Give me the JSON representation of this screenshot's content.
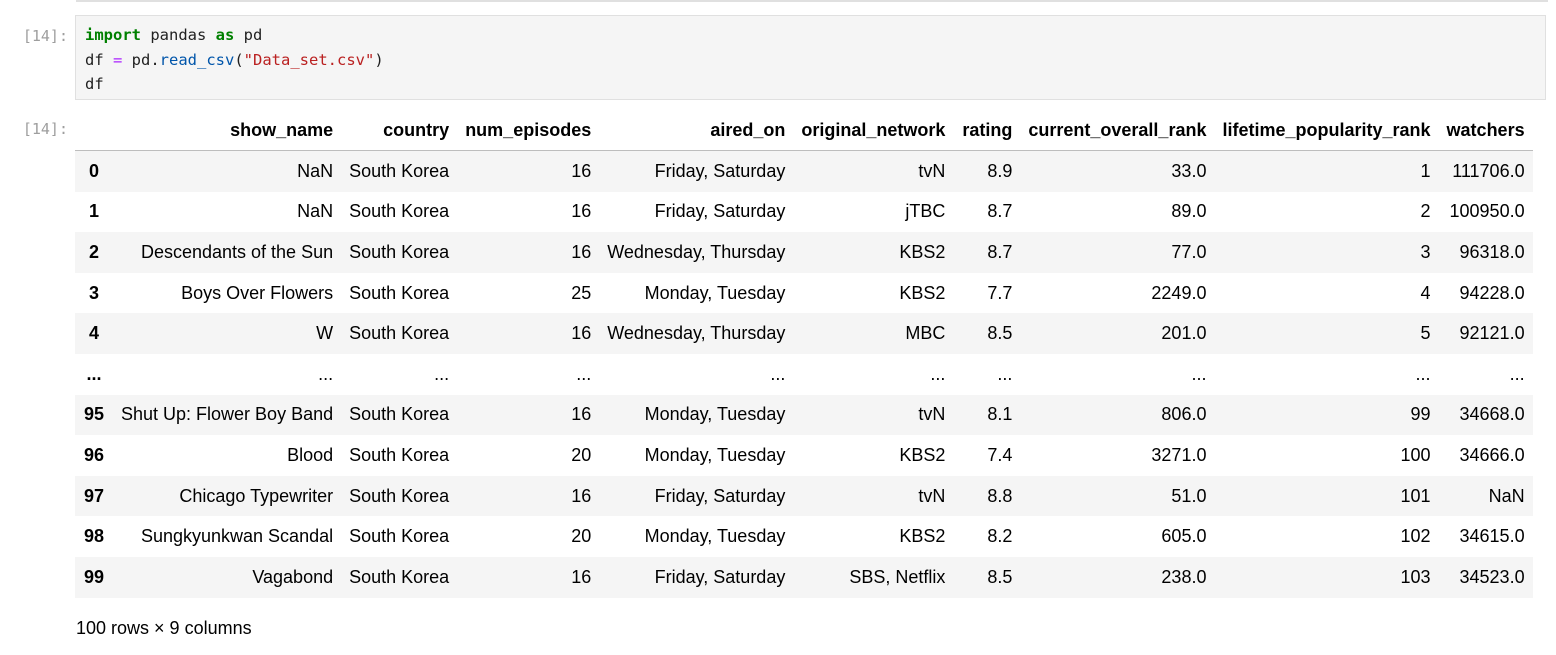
{
  "cell": {
    "in_prompt": "[14]:",
    "out_prompt": "[14]:",
    "code": {
      "line1": {
        "kw_import": "import",
        "mod": " pandas ",
        "kw_as": "as",
        "alias": " pd"
      },
      "line2": {
        "var": "df ",
        "op": "=",
        "obj": " pd.",
        "fn": "read_csv",
        "open": "(",
        "str": "\"Data_set.csv\"",
        "close": ")"
      },
      "line3": {
        "var": "df"
      }
    }
  },
  "table": {
    "columns": [
      "show_name",
      "country",
      "num_episodes",
      "aired_on",
      "original_network",
      "rating",
      "current_overall_rank",
      "lifetime_popularity_rank",
      "watchers"
    ],
    "rows": [
      {
        "index": "0",
        "cells": [
          "NaN",
          "South Korea",
          "16",
          "Friday, Saturday",
          "tvN",
          "8.9",
          "33.0",
          "1",
          "111706.0"
        ]
      },
      {
        "index": "1",
        "cells": [
          "NaN",
          "South Korea",
          "16",
          "Friday, Saturday",
          "jTBC",
          "8.7",
          "89.0",
          "2",
          "100950.0"
        ]
      },
      {
        "index": "2",
        "cells": [
          "Descendants of the Sun",
          "South Korea",
          "16",
          "Wednesday, Thursday",
          "KBS2",
          "8.7",
          "77.0",
          "3",
          "96318.0"
        ]
      },
      {
        "index": "3",
        "cells": [
          "Boys Over Flowers",
          "South Korea",
          "25",
          "Monday, Tuesday",
          "KBS2",
          "7.7",
          "2249.0",
          "4",
          "94228.0"
        ]
      },
      {
        "index": "4",
        "cells": [
          "W",
          "South Korea",
          "16",
          "Wednesday, Thursday",
          "MBC",
          "8.5",
          "201.0",
          "5",
          "92121.0"
        ]
      },
      {
        "index": "...",
        "cells": [
          "...",
          "...",
          "...",
          "...",
          "...",
          "...",
          "...",
          "...",
          "..."
        ]
      },
      {
        "index": "95",
        "cells": [
          "Shut Up: Flower Boy Band",
          "South Korea",
          "16",
          "Monday, Tuesday",
          "tvN",
          "8.1",
          "806.0",
          "99",
          "34668.0"
        ]
      },
      {
        "index": "96",
        "cells": [
          "Blood",
          "South Korea",
          "20",
          "Monday, Tuesday",
          "KBS2",
          "7.4",
          "3271.0",
          "100",
          "34666.0"
        ]
      },
      {
        "index": "97",
        "cells": [
          "Chicago Typewriter",
          "South Korea",
          "16",
          "Friday, Saturday",
          "tvN",
          "8.8",
          "51.0",
          "101",
          "NaN"
        ]
      },
      {
        "index": "98",
        "cells": [
          "Sungkyunkwan Scandal",
          "South Korea",
          "20",
          "Monday, Tuesday",
          "KBS2",
          "8.2",
          "605.0",
          "102",
          "34615.0"
        ]
      },
      {
        "index": "99",
        "cells": [
          "Vagabond",
          "South Korea",
          "16",
          "Friday, Saturday",
          "SBS, Netflix",
          "8.5",
          "238.0",
          "103",
          "34523.0"
        ]
      }
    ],
    "shape_text": "100 rows × 9 columns"
  }
}
